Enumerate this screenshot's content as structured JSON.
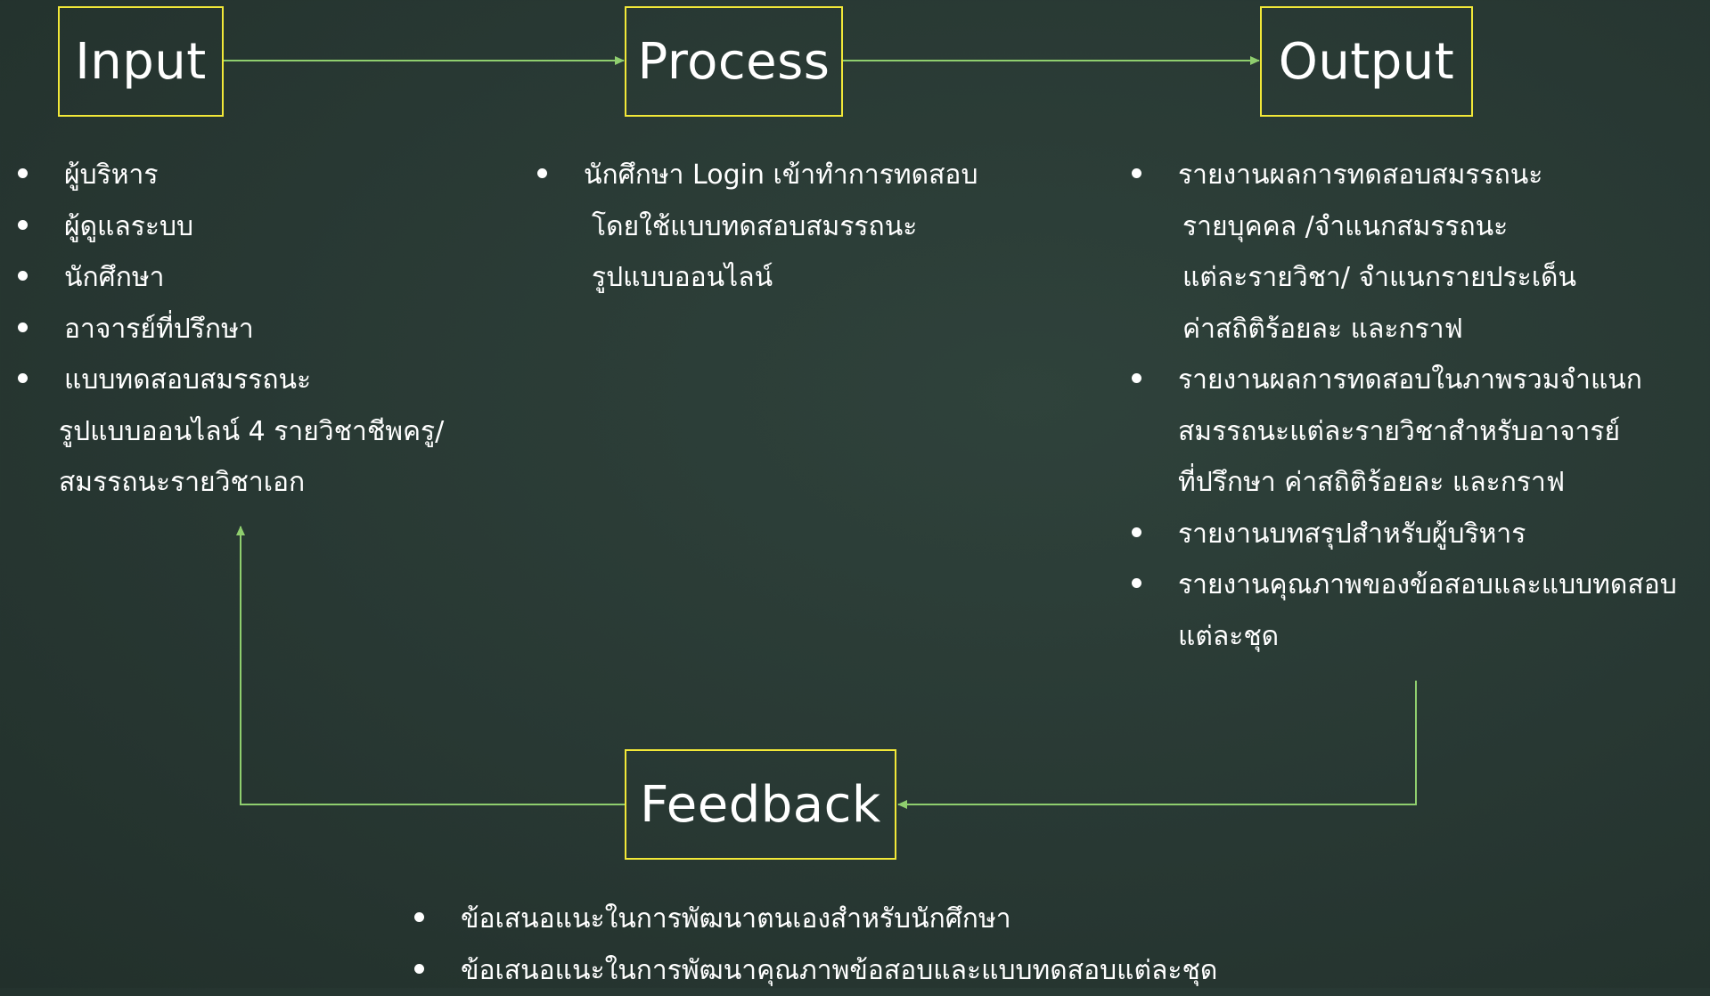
{
  "boxes": {
    "input": "Input",
    "process": "Process",
    "output": "Output",
    "feedback": "Feedback"
  },
  "colors": {
    "background": "#2a3b35",
    "box_border": "#f2e838",
    "arrow": "#8fce6e",
    "text": "#ffffff"
  },
  "input_items": {
    "item1": "ผู้บริหาร",
    "item2": "ผู้ดูแลระบบ",
    "item3": "นักศึกษา",
    "item4": "อาจารย์ที่ปรึกษา",
    "item5_line1": "แบบทดสอบสมรรถนะ",
    "item5_line2": "รูปแบบออนไลน์ 4 รายวิชาชีพครู/",
    "item5_line3": "สมรรถนะรายวิชาเอก"
  },
  "process_items": {
    "item1_line1": "นักศึกษา Login เข้าทำการทดสอบ",
    "item1_line2": "โดยใช้แบบทดสอบสมรรถนะ",
    "item1_line3": "รูปแบบออนไลน์"
  },
  "output_items": {
    "item1_line1": "รายงานผลการทดสอบสมรรถนะ",
    "item1_line2": "รายบุคคล /จำแนกสมรรถนะ",
    "item1_line3": "แต่ละรายวิชา/ จำแนกรายประเด็น",
    "item1_line4": "ค่าสถิติร้อยละ และกราฟ",
    "item2_line1": "รายงานผลการทดสอบในภาพรวมจำแนก",
    "item2_line2": "สมรรถนะแต่ละรายวิชาสำหรับอาจารย์",
    "item2_line3": "ที่ปรึกษา ค่าสถิติร้อยละ และกราฟ",
    "item3": "รายงานบทสรุปสำหรับผู้บริหาร",
    "item4_line1": "รายงานคุณภาพของข้อสอบและแบบทดสอบ",
    "item4_line2": "แต่ละชุด"
  },
  "feedback_items": {
    "item1": "ข้อเสนอแนะในการพัฒนาตนเองสำหรับนักศึกษา",
    "item2": "ข้อเสนอแนะในการพัฒนาคุณภาพข้อสอบและแบบทดสอบแต่ละชุด"
  }
}
